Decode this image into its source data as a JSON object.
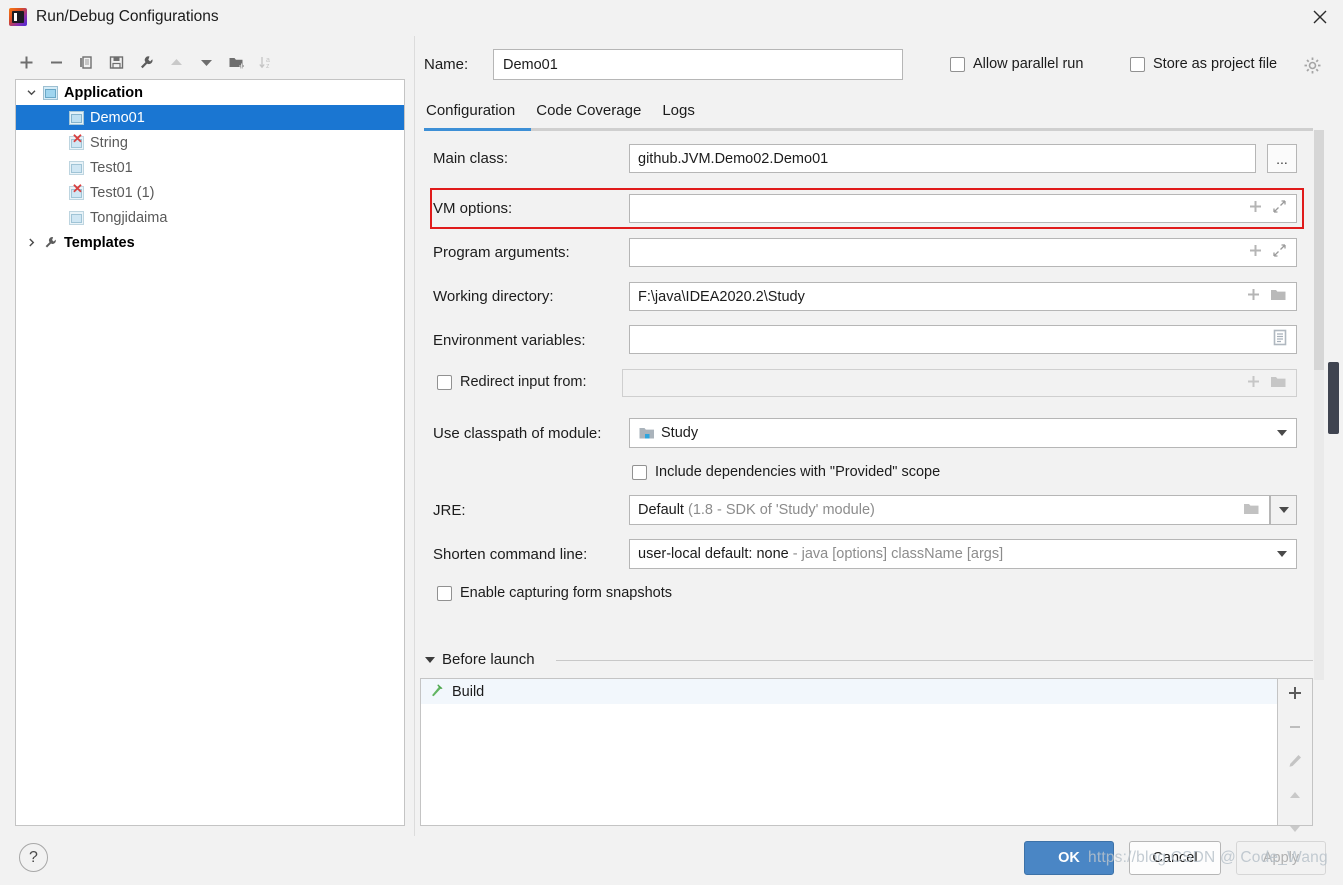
{
  "window": {
    "title": "Run/Debug Configurations",
    "app_icon": "intellij-idea-icon",
    "close_icon": "close-icon"
  },
  "left_toolbar": {
    "buttons": [
      {
        "name": "add-configuration-button",
        "icon": "plus-icon",
        "enabled": true
      },
      {
        "name": "remove-configuration-button",
        "icon": "minus-icon",
        "enabled": true
      },
      {
        "name": "copy-configuration-button",
        "icon": "copy-icon",
        "enabled": true
      },
      {
        "name": "save-configuration-button",
        "icon": "save-icon",
        "enabled": true
      },
      {
        "name": "edit-templates-button",
        "icon": "wrench-icon",
        "enabled": true
      },
      {
        "name": "move-up-button",
        "icon": "arrow-up-icon",
        "enabled": false
      },
      {
        "name": "move-down-button",
        "icon": "arrow-down-icon",
        "enabled": true
      },
      {
        "name": "new-folder-button",
        "icon": "folder-add-icon",
        "enabled": true
      },
      {
        "name": "sort-alphabetically-button",
        "icon": "sort-az-icon",
        "enabled": false
      }
    ]
  },
  "tree": {
    "nodes": [
      {
        "label": "Application",
        "type": "group",
        "expanded": true,
        "icon": "application-icon",
        "selected": false,
        "error": false
      },
      {
        "label": "Demo01",
        "type": "child",
        "icon": "config-icon",
        "selected": true,
        "error": false
      },
      {
        "label": "String",
        "type": "child",
        "icon": "config-icon",
        "selected": false,
        "error": true
      },
      {
        "label": "Test01",
        "type": "child",
        "icon": "config-icon",
        "selected": false,
        "error": false
      },
      {
        "label": "Test01 (1)",
        "type": "child",
        "icon": "config-icon",
        "selected": false,
        "error": true
      },
      {
        "label": "Tongjidaima",
        "type": "child",
        "icon": "config-icon",
        "selected": false,
        "error": false
      },
      {
        "label": "Templates",
        "type": "group",
        "expanded": false,
        "icon": "wrench-icon",
        "selected": false,
        "error": false
      }
    ]
  },
  "header": {
    "name_label": "Name:",
    "name_value": "Demo01",
    "allow_parallel_run_label": "Allow parallel run",
    "allow_parallel_run_checked": false,
    "store_as_project_file_label": "Store as project file",
    "store_as_project_file_checked": false,
    "gear_icon": "gear-icon"
  },
  "tabs": {
    "items": [
      {
        "label": "Configuration",
        "active": true
      },
      {
        "label": "Code Coverage",
        "active": false
      },
      {
        "label": "Logs",
        "active": false
      }
    ]
  },
  "form": {
    "main_class": {
      "label": "Main class:",
      "value": "github.JVM.Demo02.Demo01",
      "browse_label": "...",
      "browse_icon": "ellipsis-icon"
    },
    "vm_options": {
      "label": "VM options:",
      "value": "",
      "icons": [
        "plus-icon",
        "expand-icon"
      ],
      "highlighted": true,
      "highlight_color": "#e01b1b"
    },
    "program_arguments": {
      "label": "Program arguments:",
      "value": "",
      "icons": [
        "plus-icon",
        "expand-icon"
      ]
    },
    "working_directory": {
      "label": "Working directory:",
      "value": "F:\\java\\IDEA2020.2\\Study",
      "icons": [
        "plus-icon",
        "folder-icon"
      ]
    },
    "environment_variables": {
      "label": "Environment variables:",
      "value": "",
      "icons": [
        "list-edit-icon"
      ]
    },
    "redirect_input": {
      "label": "Redirect input from:",
      "checked": false,
      "value": "",
      "disabled": true,
      "icons": [
        "plus-icon",
        "folder-icon"
      ]
    },
    "use_classpath_of_module": {
      "label": "Use classpath of module:",
      "value": "Study",
      "value_icon": "module-icon",
      "dropdown_icon": "chevron-down-icon"
    },
    "include_provided_scope": {
      "label": "Include dependencies with \"Provided\" scope",
      "checked": false
    },
    "jre": {
      "label": "JRE:",
      "value": "Default",
      "value_hint": "(1.8 - SDK of 'Study' module)",
      "icons": [
        "folder-icon",
        "chevron-down-icon"
      ]
    },
    "shorten_command_line": {
      "label": "Shorten command line:",
      "value": "user-local default: none",
      "value_hint": "- java [options] className [args]",
      "dropdown_icon": "chevron-down-icon"
    },
    "enable_form_snapshots": {
      "label": "Enable capturing form snapshots",
      "checked": false
    }
  },
  "before_launch": {
    "title": "Before launch",
    "expanded": true,
    "items": [
      {
        "label": "Build",
        "icon": "build-hammer-icon"
      }
    ],
    "side_buttons": [
      {
        "name": "add-task-button",
        "icon": "plus-icon",
        "enabled": true
      },
      {
        "name": "remove-task-button",
        "icon": "minus-icon",
        "enabled": false
      },
      {
        "name": "edit-task-button",
        "icon": "pencil-icon",
        "enabled": false
      },
      {
        "name": "move-task-up-button",
        "icon": "arrow-up-icon",
        "enabled": false
      },
      {
        "name": "move-task-down-button",
        "icon": "arrow-down-icon",
        "enabled": false
      }
    ]
  },
  "footer": {
    "help_label": "?",
    "ok_label": "OK",
    "cancel_label": "Cancel",
    "apply_label": "Apply",
    "apply_enabled": false,
    "ok_color": "#4a86c5"
  },
  "watermark": {
    "text": "https://blog.CSDN @ Code_Wang"
  }
}
